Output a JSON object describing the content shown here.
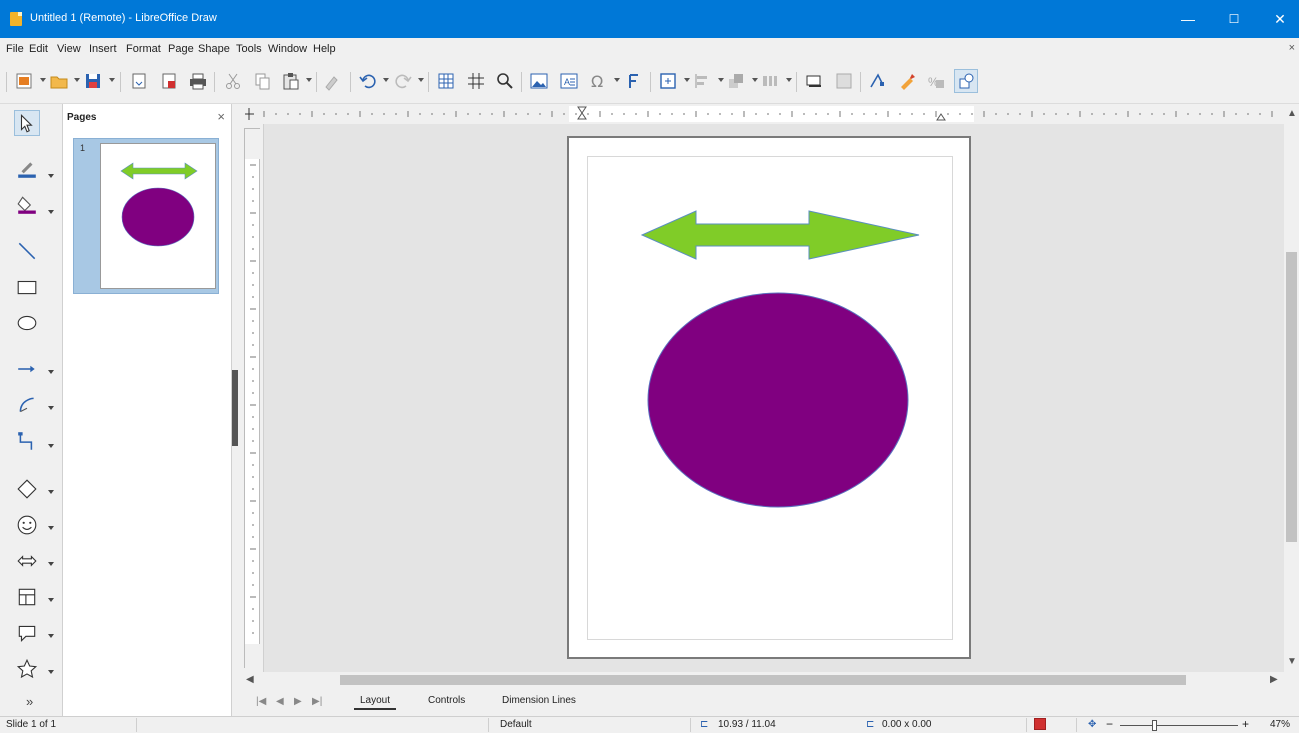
{
  "window": {
    "title": "Untitled 1 (Remote) - LibreOffice Draw",
    "minimize": "—",
    "maximize": "☐",
    "close": "✕"
  },
  "menu": [
    "File",
    "Edit",
    "View",
    "Insert",
    "Format",
    "Page",
    "Shape",
    "Tools",
    "Window",
    "Help"
  ],
  "menu_close": "×",
  "pages_pane": {
    "title": "Pages",
    "close": "×",
    "page_number": "1"
  },
  "tabs": [
    "Layout",
    "Controls",
    "Dimension Lines"
  ],
  "tab_nav": [
    "|◀",
    "◀",
    "▶",
    "▶|"
  ],
  "status": {
    "slide": "Slide 1 of 1",
    "master": "Default",
    "position": "10.93 / 11.04",
    "size": "0.00 x 0.00",
    "zoom": "47%",
    "zoom_minus": "−",
    "zoom_plus": "+"
  },
  "more_tools": "»",
  "colors": {
    "arrow_fill": "#80cc28",
    "arrow_stroke": "#5a8fbf",
    "ellipse_fill": "#800080",
    "ellipse_stroke": "#5a6fbf",
    "titlebar": "#0078d7"
  }
}
